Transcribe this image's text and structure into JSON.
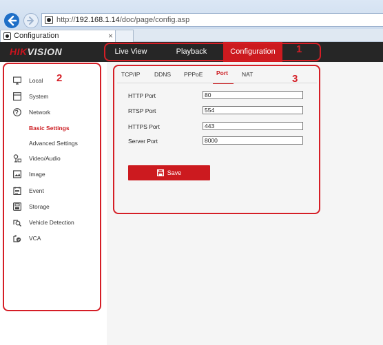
{
  "browser": {
    "address_prefix": "http://",
    "address_host": "192.168.1.14",
    "address_path": "/doc/page/config.asp",
    "tab_title": "Configuration",
    "tab_close": "×"
  },
  "app": {
    "logo_red": "HIK",
    "logo_rest": "VISION",
    "topnav": [
      {
        "label": "Live View"
      },
      {
        "label": "Playback"
      },
      {
        "label": "Configuration"
      }
    ],
    "accent_color": "#cc1a1f"
  },
  "sidebar": {
    "items": [
      {
        "label": "Local",
        "icon": "monitor-icon"
      },
      {
        "label": "System",
        "icon": "system-icon"
      },
      {
        "label": "Network",
        "icon": "globe-icon"
      },
      {
        "label": "Basic Settings",
        "icon": ""
      },
      {
        "label": "Advanced Settings",
        "icon": ""
      },
      {
        "label": "Video/Audio",
        "icon": "video-audio-icon"
      },
      {
        "label": "Image",
        "icon": "image-icon"
      },
      {
        "label": "Event",
        "icon": "event-icon"
      },
      {
        "label": "Storage",
        "icon": "storage-icon"
      },
      {
        "label": "Vehicle Detection",
        "icon": "vehicle-detection-icon"
      },
      {
        "label": "VCA",
        "icon": "vca-icon"
      }
    ]
  },
  "main": {
    "tabs": [
      {
        "label": "TCP/IP"
      },
      {
        "label": "DDNS"
      },
      {
        "label": "PPPoE"
      },
      {
        "label": "Port"
      },
      {
        "label": "NAT"
      }
    ],
    "fields": [
      {
        "label": "HTTP Port",
        "value": "80"
      },
      {
        "label": "RTSP Port",
        "value": "554"
      },
      {
        "label": "HTTPS Port",
        "value": "443"
      },
      {
        "label": "Server Port",
        "value": "8000"
      }
    ],
    "save_label": "Save"
  },
  "annotations": [
    {
      "number": "1"
    },
    {
      "number": "2"
    },
    {
      "number": "3"
    }
  ]
}
